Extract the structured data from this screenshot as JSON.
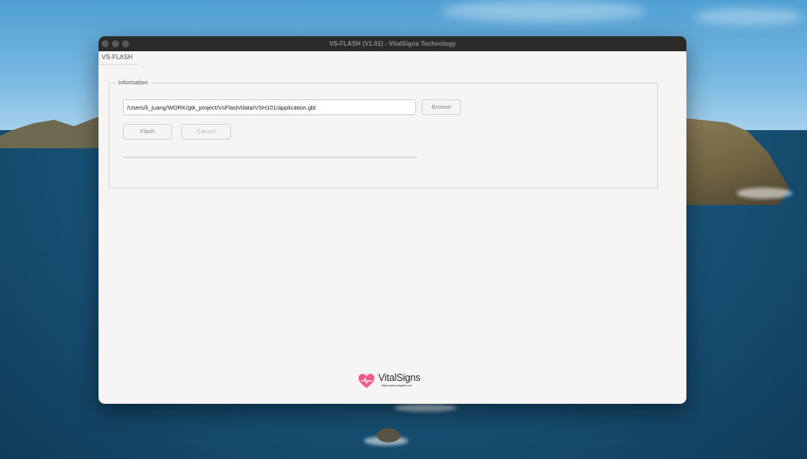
{
  "window": {
    "title": "VS-FLASH (V1.01) - VitalSigns Technology"
  },
  "tab": {
    "label": "VS-FLASH"
  },
  "information": {
    "label": "Information",
    "path_value": "/Users/li_juang/WORK/gtk_project/VsFlash/data/VSH101/application.gbl",
    "browse_label": "Browse",
    "flash_label": "Flash",
    "cancel_label": "Cancel",
    "progress": 0
  },
  "logo": {
    "name": "VitalSigns",
    "url": "https://www.vsigntek.com",
    "heart_color": "#ef5a8f"
  }
}
